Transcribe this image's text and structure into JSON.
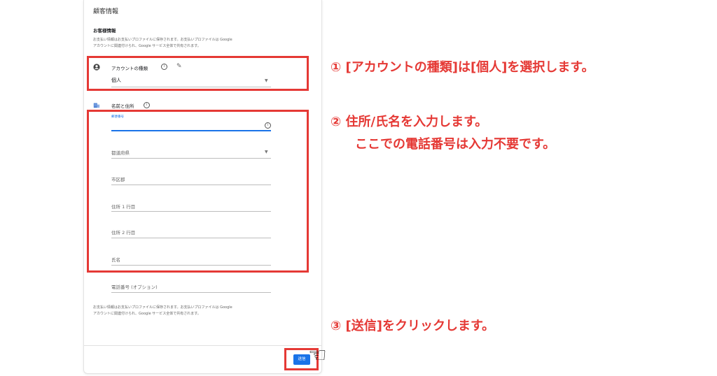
{
  "panel": {
    "title": "顧客情報",
    "section_title": "お客様情報",
    "info_top": [
      "お支払い情報はお支払いプロファイルに保存されます。お支払いプロファイルは Google",
      "アカウントに関連付けられ、Google サービス全体で共有されます。"
    ],
    "account_type_label": "アカウントの種類",
    "account_type_value": "個人",
    "name_address_label": "名前と住所",
    "postal_code_label": "郵便番号",
    "prefecture_label": "都道府県",
    "city_label": "市区郡",
    "address1_label": "住所 1 行目",
    "address2_label": "住所 2 行目",
    "name_label": "氏名",
    "phone_label": "電話番号 (オプション)",
    "info_bottom": [
      "お支払い情報はお支払いプロファイルに保存されます。お支払いプロファイルは Google",
      "アカウントに関連付けられ、Google サービス全体で共有されます。"
    ],
    "submit_label": "送信"
  },
  "icons": {
    "account": "account-circle-icon",
    "info": "info-icon",
    "edit": "pencil-icon",
    "business": "business-icon",
    "dropdown": "caret-down-icon",
    "pointer": "pointing-hand-icon"
  },
  "annotations": {
    "step1": "① [アカウントの種類]は[個人]を選択します。",
    "step2_line1": "② 住所/氏名を入力します。",
    "step2_line2": "ここでの電話番号は入力不要です。",
    "step3": "③ [送信]をクリックします。"
  },
  "colors": {
    "annotation_red": "#e53935",
    "accent_blue": "#1a73e8"
  }
}
